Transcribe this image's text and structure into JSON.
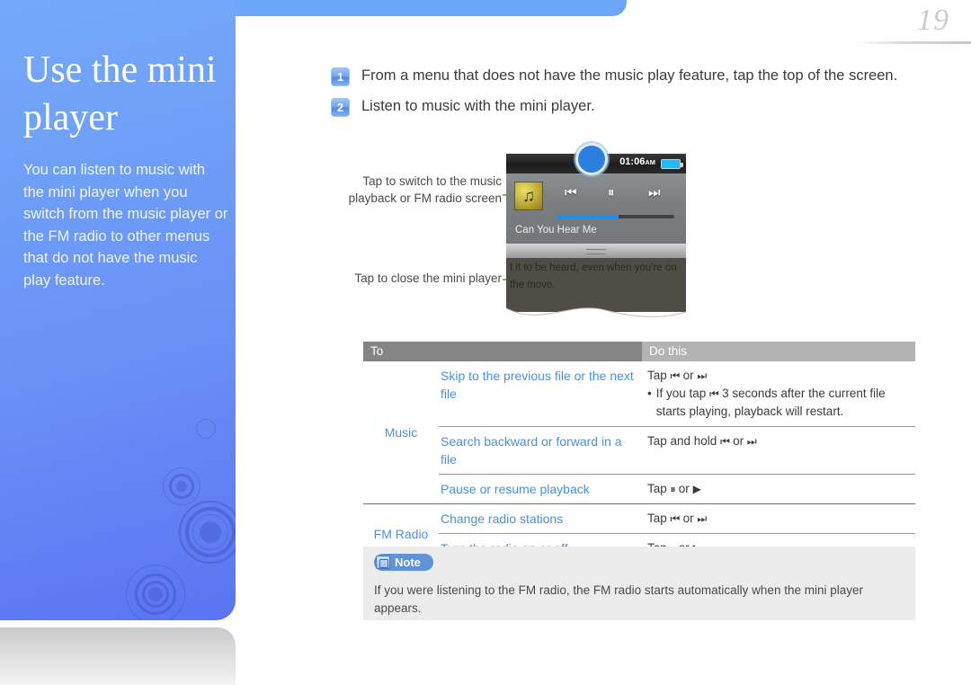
{
  "page": {
    "number": "19"
  },
  "sidebar": {
    "title": "Use the mini player",
    "description": "You can listen to music with the mini player when you switch from the music player or the FM radio to other menus that do not have the music play feature."
  },
  "steps": [
    {
      "num": "1",
      "text": "From a menu that does not have the music play feature, tap the top of the screen."
    },
    {
      "num": "2",
      "text": "Listen to music with the mini player."
    }
  ],
  "device": {
    "time": "01:06",
    "time_suffix": "AM",
    "track_title": "Can You Hear Me",
    "lyrics": "t it to be heard, even when you're on the move.",
    "prev_icon": "skip-backward-icon",
    "pause_icon": "pause-icon",
    "next_icon": "skip-forward-icon",
    "prev_glyph": "⏮",
    "pause_glyph": "⏸",
    "next_glyph": "⏭"
  },
  "callouts": [
    {
      "text": "Tap to switch to the music playback or FM radio screen"
    },
    {
      "text": "Tap to close the mini player"
    }
  ],
  "table": {
    "headers": {
      "to": "To",
      "do_this": "Do this"
    },
    "groups": [
      {
        "label": "Music",
        "rows": [
          {
            "to": "Skip to the previous file or the next file",
            "do_line1_pre": "Tap ",
            "do_line1_icon1": "⏮",
            "do_line1_mid": " or ",
            "do_line1_icon2": "⏭",
            "bullet_pre": "If you tap ",
            "bullet_icon": "⏮",
            "bullet_post": " 3 seconds after the current file starts playing, playback will restart."
          },
          {
            "to": "Search backward or forward in a file",
            "do_line1_pre": "Tap and hold ",
            "do_line1_icon1": "⏮",
            "do_line1_mid": " or ",
            "do_line1_icon2": "⏭"
          },
          {
            "to": "Pause or resume playback",
            "do_line1_pre": "Tap ",
            "do_line1_icon1": "⏸",
            "do_line1_mid": " or ",
            "do_line1_icon2": "▶"
          }
        ]
      },
      {
        "label": "FM Radio",
        "rows": [
          {
            "to": "Change radio stations",
            "do_line1_pre": "Tap ",
            "do_line1_icon1": "⏮",
            "do_line1_mid": " or ",
            "do_line1_icon2": "⏭"
          },
          {
            "to": "Turn the radio on or off",
            "do_line1_pre": "Tap ",
            "do_line1_icon1": "⏸",
            "do_line1_mid": " or ",
            "do_line1_icon2": "▶"
          }
        ]
      }
    ]
  },
  "note": {
    "label": "Note",
    "text": "If you were listening to the FM radio, the FM radio starts automatically when the mini player appears."
  },
  "colors": {
    "sidebar_blue": "#6b93f7",
    "accent_blue": "#4a90e2",
    "note_pill": "#5d93d8",
    "leader_green": "#7ab648",
    "header_dark": "#858585",
    "header_light": "#b3b3b3"
  }
}
